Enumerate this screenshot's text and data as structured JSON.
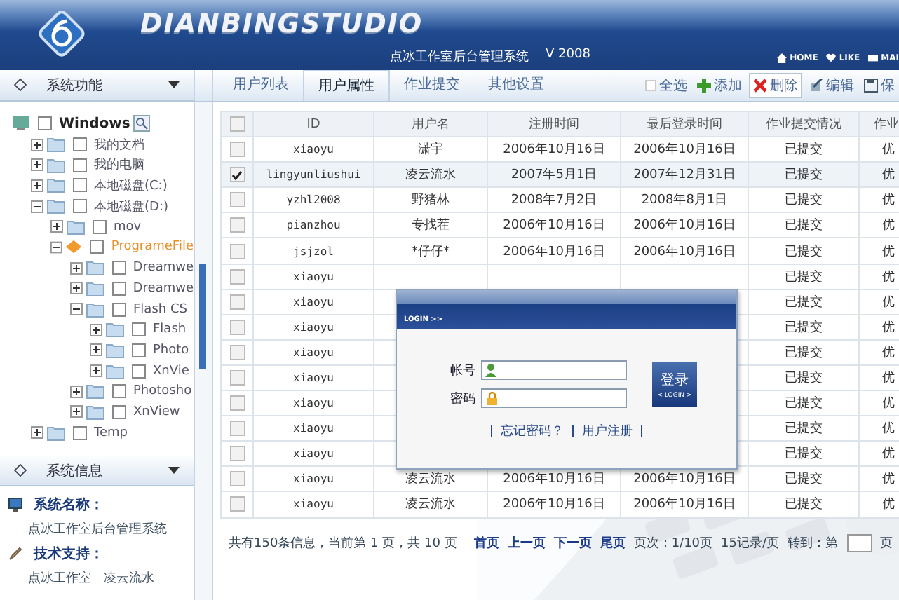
{
  "header": {
    "logo": "DIANBINGSTUDIO",
    "subtitle": "点冰工作室后台管理系统",
    "version": "V 2008",
    "links": [
      {
        "label": "HOME",
        "kind": "home"
      },
      {
        "label": "LIKE",
        "kind": "heart"
      },
      {
        "label": "MAI",
        "kind": "mail"
      }
    ]
  },
  "sidebar": {
    "title": "系统功能",
    "tree": [
      {
        "label": "Windows",
        "kind": "root",
        "checked": false,
        "children": [
          {
            "label": "我的文档",
            "checked": false,
            "expanded": false,
            "selected": false
          },
          {
            "label": "我的电脑",
            "checked": false,
            "expanded": false,
            "selected": false
          },
          {
            "label": "本地磁盘(C:)",
            "checked": false,
            "expanded": false,
            "selected": false
          },
          {
            "label": "本地磁盘(D:)",
            "checked": false,
            "expanded": true,
            "selected": false,
            "children": [
              {
                "label": "mov",
                "checked": false,
                "expanded": false,
                "selected": false
              },
              {
                "label": "ProgrameFile",
                "checked": false,
                "expanded": true,
                "selected": true,
                "children": [
                  {
                    "label": "Dreamwe",
                    "checked": false,
                    "expanded": false,
                    "selected": false
                  },
                  {
                    "label": "Dreamwe",
                    "checked": false,
                    "expanded": false,
                    "selected": false
                  },
                  {
                    "label": "Flash CS",
                    "checked": false,
                    "expanded": true,
                    "selected": false,
                    "children": [
                      {
                        "label": "Flash",
                        "checked": false,
                        "expanded": false,
                        "selected": false
                      },
                      {
                        "label": "Photo",
                        "checked": false,
                        "expanded": false,
                        "selected": false
                      },
                      {
                        "label": "XnVie",
                        "checked": false,
                        "expanded": false,
                        "selected": false
                      }
                    ]
                  },
                  {
                    "label": "Photosho",
                    "checked": false,
                    "expanded": false,
                    "selected": false
                  },
                  {
                    "label": "XnView",
                    "checked": false,
                    "expanded": false,
                    "selected": false
                  }
                ]
              }
            ]
          },
          {
            "label": "Temp",
            "checked": false,
            "expanded": false,
            "selected": false
          }
        ]
      }
    ],
    "info_title": "系统信息",
    "info": [
      {
        "label": "系统名称：",
        "value": "点冰工作室后台管理系统",
        "kind": "monitor"
      },
      {
        "label": "技术支持：",
        "value": "点冰工作室　凌云流水",
        "kind": "pen"
      }
    ]
  },
  "tabs": [
    {
      "label": "用户列表",
      "selected": false
    },
    {
      "label": "用户属性",
      "selected": true
    },
    {
      "label": "作业提交",
      "selected": false
    },
    {
      "label": "其他设置",
      "selected": false
    }
  ],
  "toolbar": [
    {
      "label": "全选",
      "kind": "checkbox",
      "selected": false
    },
    {
      "label": "添加",
      "kind": "add",
      "selected": false
    },
    {
      "label": "删除",
      "kind": "delete",
      "selected": true
    },
    {
      "label": "编辑",
      "kind": "edit",
      "selected": false
    },
    {
      "label": "保",
      "kind": "save",
      "selected": false
    }
  ],
  "table": {
    "all_selected": false,
    "columns": [
      "ID",
      "用户名",
      "注册时间",
      "最后登录时间",
      "作业提交情况",
      "作业"
    ],
    "rows": [
      {
        "selected": false,
        "id": "xiaoyu",
        "name": "潇宇",
        "registered": "2006年10月16日",
        "last_login": "2006年10月16日",
        "status": "已提交",
        "column_7": "优"
      },
      {
        "selected": true,
        "id": "lingyunliushui",
        "name": "凌云流水",
        "registered": "2007年5月1日",
        "last_login": "2007年12月31日",
        "status": "已提交",
        "column_7": "优"
      },
      {
        "selected": false,
        "id": "yzhl2008",
        "name": "野猪林",
        "registered": "2008年7月2日",
        "last_login": "2008年8月1日",
        "status": "已提交",
        "column_7": "优"
      },
      {
        "selected": false,
        "id": "pianzhou",
        "name": "专找茬",
        "registered": "2006年10月16日",
        "last_login": "2006年10月16日",
        "status": "已提交",
        "column_7": "优"
      },
      {
        "selected": false,
        "id": "jsjzol",
        "name": "*仔仔*",
        "registered": "2006年10月16日",
        "last_login": "2006年10月16日",
        "status": "已提交",
        "column_7": "优"
      },
      {
        "selected": false,
        "id": "xiaoyu",
        "status": "已提交",
        "column_7": "优"
      },
      {
        "selected": false,
        "id": "xiaoyu",
        "status": "已提交",
        "column_7": "优"
      },
      {
        "selected": false,
        "id": "xiaoyu",
        "status": "已提交",
        "column_7": "优"
      },
      {
        "selected": false,
        "id": "xiaoyu",
        "status": "已提交",
        "column_7": "优"
      },
      {
        "selected": false,
        "id": "xiaoyu",
        "status": "已提交",
        "column_7": "优"
      },
      {
        "selected": false,
        "id": "xiaoyu",
        "status": "已提交",
        "column_7": "优"
      },
      {
        "selected": false,
        "id": "xiaoyu",
        "status": "已提交",
        "column_7": "优"
      },
      {
        "selected": false,
        "id": "xiaoyu",
        "status": "已提交",
        "column_7": "优"
      },
      {
        "selected": false,
        "id": "xiaoyu",
        "name": "凌云流水",
        "registered": "2006年10月16日",
        "last_login": "2006年10月16日",
        "status": "已提交",
        "column_7": "优"
      },
      {
        "selected": false,
        "id": "xiaoyu",
        "name": "凌云流水",
        "registered": "2006年10月16日",
        "last_login": "2006年10月16日",
        "status": "已提交",
        "column_7": "优"
      }
    ]
  },
  "pagination": {
    "summary": "共有150条信息，当前第 1 页，共 10 页",
    "links": [
      "首页",
      "上一页",
      "下一页",
      "尾页"
    ],
    "page_info": "页次：1/10页",
    "per_page": "15记录/页",
    "goto_label": "转到：第",
    "goto_suffix": "页"
  },
  "login_dialog": {
    "title": "LOGIN >>",
    "fields": [
      {
        "label": "帐号",
        "kind": "user"
      },
      {
        "label": "密码",
        "kind": "lock"
      }
    ],
    "button": "登录",
    "button_sub": "< LOGIN >",
    "links": [
      "忘记密码？",
      "用户注册"
    ]
  }
}
